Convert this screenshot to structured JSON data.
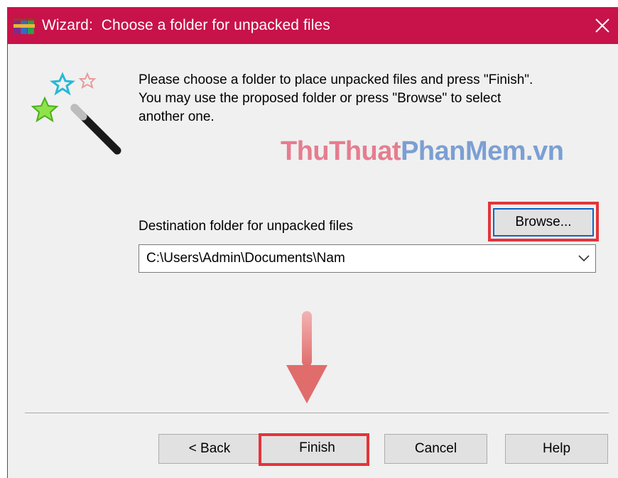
{
  "window": {
    "title": "Wizard:  Choose a folder for unpacked files",
    "app_icon": "winrar-icon",
    "close_icon": "close-icon",
    "title_color": "#c8124a"
  },
  "instructions": {
    "line1": "Please choose a folder to place unpacked files and press \"Finish\".",
    "line2": "You may use the proposed folder or press \"Browse\" to select",
    "line3": "another one."
  },
  "watermark": {
    "part1": "ThuThuat",
    "part2": "PhanMem.vn"
  },
  "destination": {
    "label": "Destination folder for unpacked files",
    "value": "C:\\Users\\Admin\\Documents\\Nam",
    "browse_label": "Browse..."
  },
  "buttons": {
    "back": "< Back",
    "finish": "Finish",
    "cancel": "Cancel",
    "help": "Help"
  },
  "highlights": {
    "color": "#e3343a"
  }
}
